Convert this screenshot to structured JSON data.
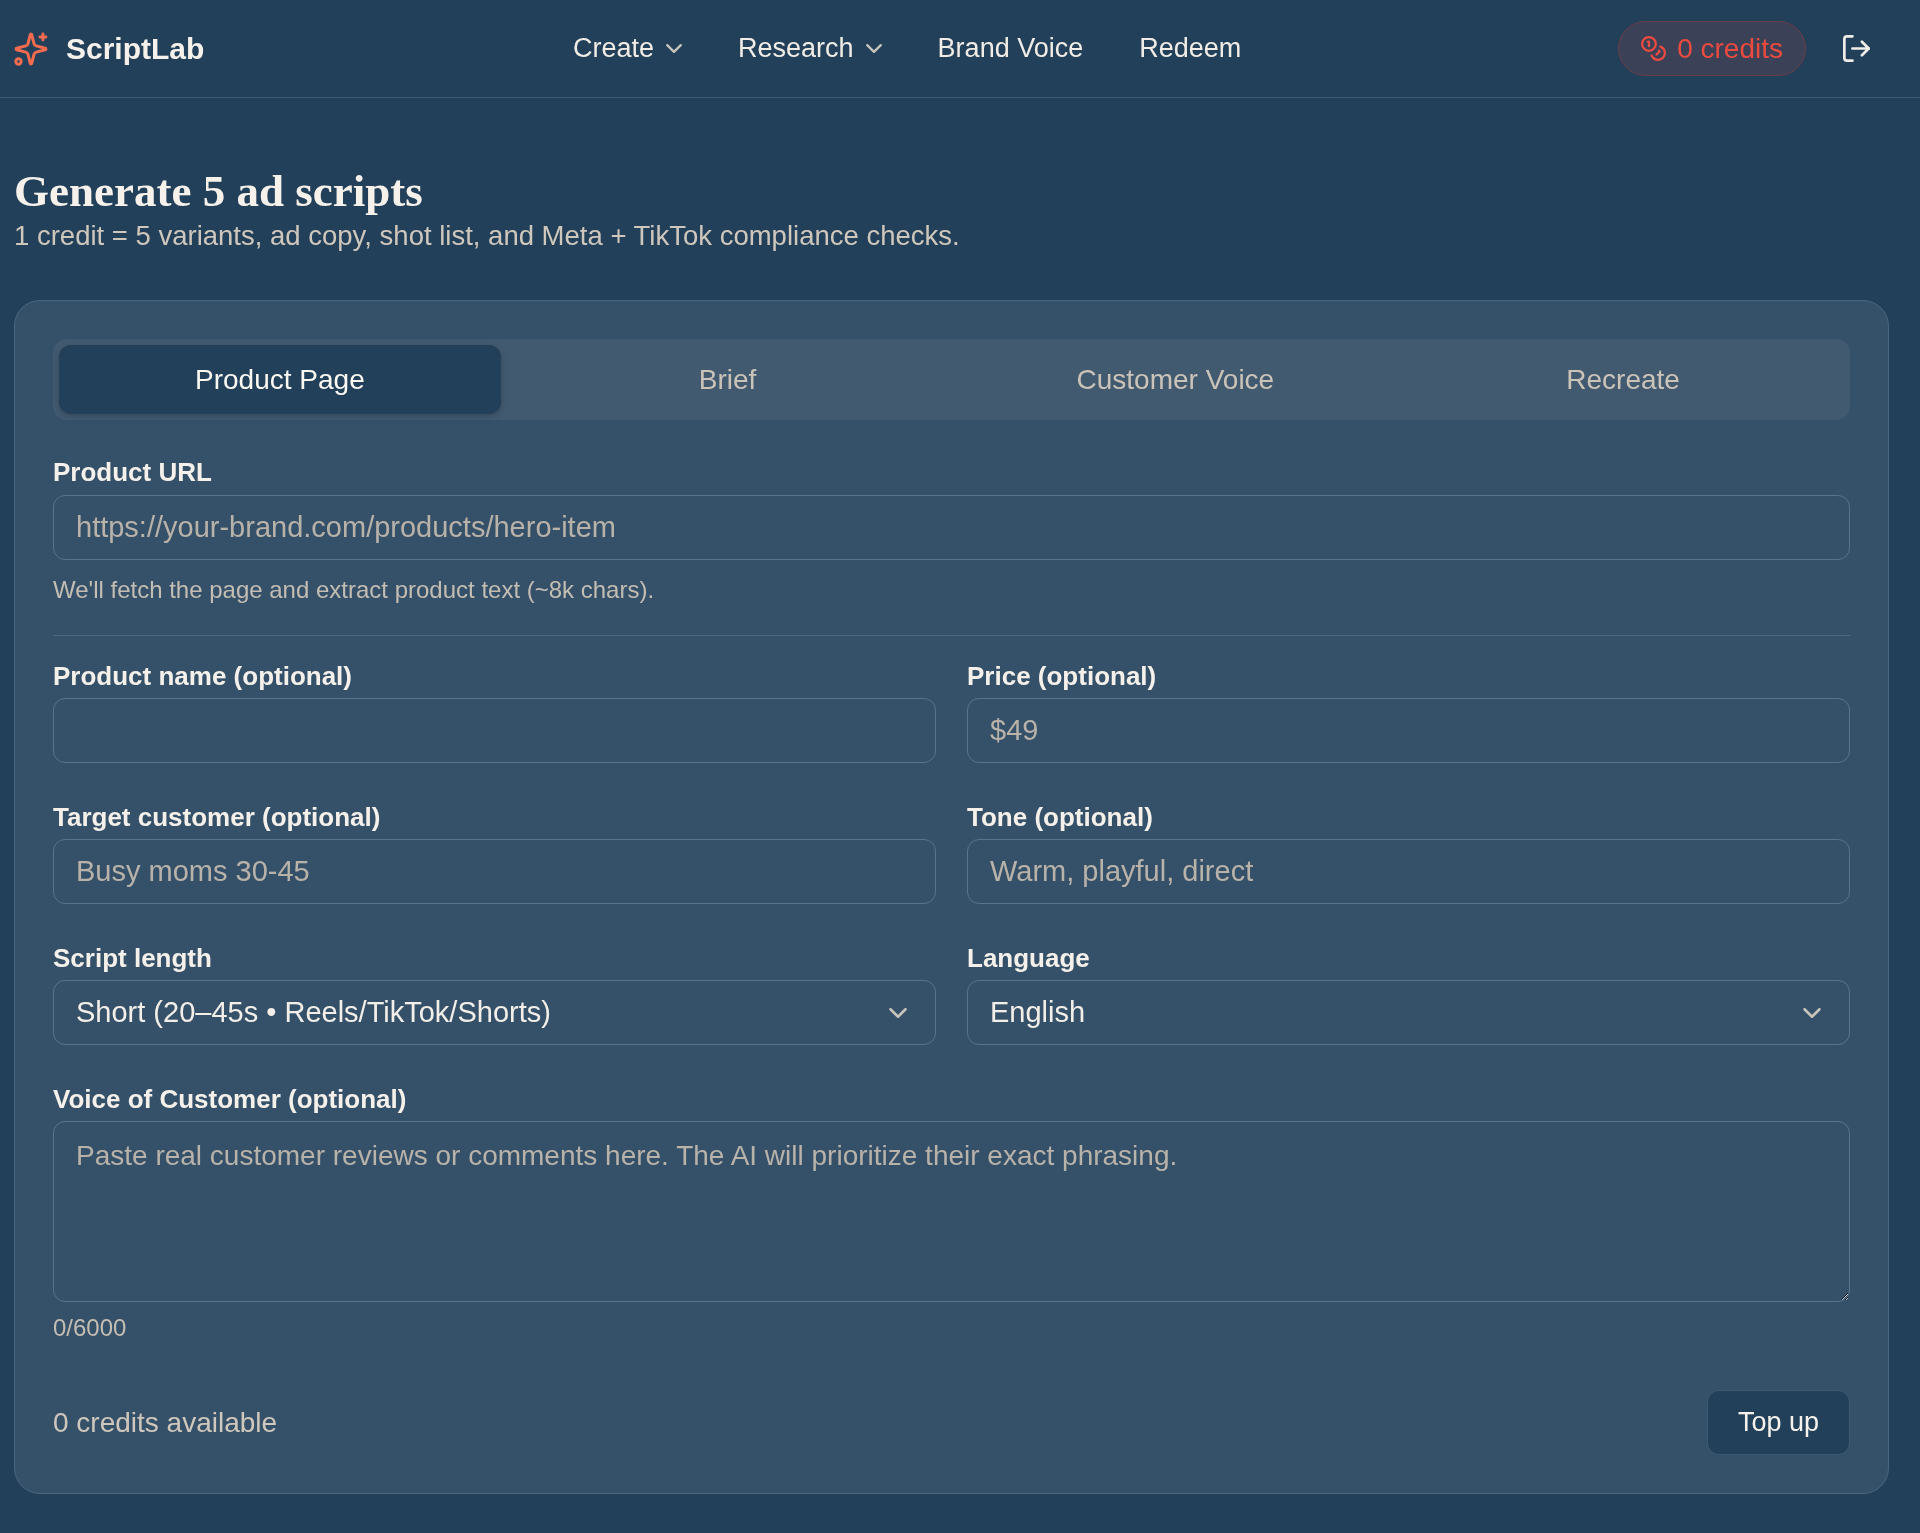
{
  "header": {
    "brand": "ScriptLab",
    "nav": [
      {
        "label": "Create",
        "kind": "dropdown"
      },
      {
        "label": "Research",
        "kind": "dropdown"
      },
      {
        "label": "Brand Voice",
        "kind": "link"
      },
      {
        "label": "Redeem",
        "kind": "link"
      }
    ],
    "credits_badge": "0 credits"
  },
  "page": {
    "title": "Generate 5 ad scripts",
    "subtitle": "1 credit = 5 variants, ad copy, shot list, and Meta + TikTok compliance checks."
  },
  "tabs": [
    {
      "label": "Product Page",
      "selected": true
    },
    {
      "label": "Brief",
      "selected": false
    },
    {
      "label": "Customer Voice",
      "selected": false
    },
    {
      "label": "Recreate",
      "selected": false
    }
  ],
  "url_field": {
    "label": "Product URL",
    "placeholder": "https://your-brand.com/products/hero-item",
    "hint": "We'll fetch the page and extract product text (~8k chars)."
  },
  "fields": [
    {
      "kind": "input",
      "label": "Product name (optional)"
    },
    {
      "kind": "input",
      "label": "Price (optional)",
      "placeholder": "$49"
    },
    {
      "kind": "input",
      "label": "Target customer (optional)",
      "placeholder": "Busy moms 30-45"
    },
    {
      "kind": "input",
      "label": "Tone (optional)",
      "placeholder": "Warm, playful, direct"
    },
    {
      "kind": "select",
      "label": "Script length",
      "value": "Short (20–45s • Reels/TikTok/Shorts)"
    },
    {
      "kind": "select",
      "label": "Language",
      "value": "English"
    }
  ],
  "voice_field": {
    "label": "Voice of Customer (optional)",
    "placeholder": "Paste real customer reviews or comments here. The AI will prioritize their exact phrasing.",
    "counter": "0/6000"
  },
  "footer": {
    "credits_text": "0 credits available",
    "button": "Top up"
  }
}
